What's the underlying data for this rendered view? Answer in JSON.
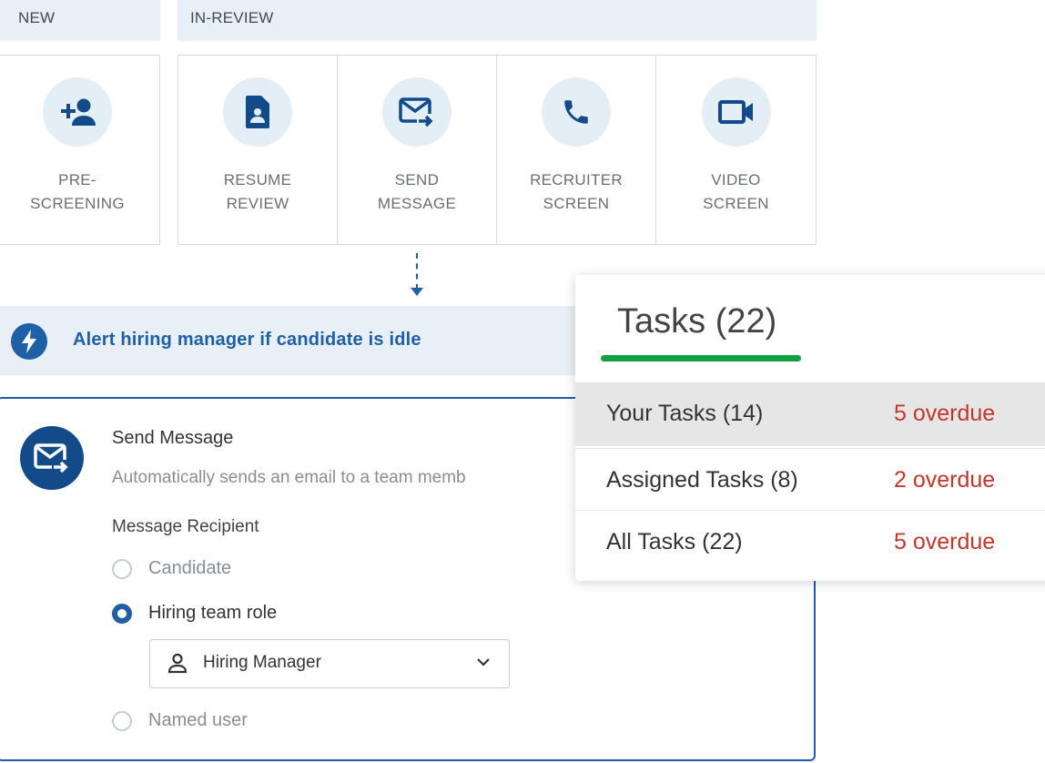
{
  "columns": {
    "new": "NEW",
    "in_review": "IN-REVIEW"
  },
  "stages": [
    {
      "label": "PRE-\nSCREENING",
      "icon": "add-person-icon"
    },
    {
      "label": "RESUME\nREVIEW",
      "icon": "document-person-icon"
    },
    {
      "label": "SEND\nMESSAGE",
      "icon": "mail-forward-icon"
    },
    {
      "label": "RECRUITER\nSCREEN",
      "icon": "phone-icon"
    },
    {
      "label": "VIDEO\nSCREEN",
      "icon": "video-camera-icon"
    }
  ],
  "alert": {
    "text": "Alert hiring manager if candidate is idle",
    "icon": "lightning-icon"
  },
  "send_message": {
    "title": "Send Message",
    "description": "Automatically sends an email to a team memb",
    "recipient_label": "Message Recipient",
    "options": [
      {
        "label": "Candidate",
        "selected": false
      },
      {
        "label": "Hiring team role",
        "selected": true
      },
      {
        "label": "Named user",
        "selected": false
      }
    ],
    "role_select": {
      "value": "Hiring Manager"
    }
  },
  "tasks": {
    "heading": "Tasks (22)",
    "rows": [
      {
        "name": "Your Tasks (14)",
        "overdue": "5 overdue",
        "active": true
      },
      {
        "name": "Assigned Tasks (8)",
        "overdue": "2 overdue",
        "active": false
      },
      {
        "name": "All Tasks (22)",
        "overdue": "5 overdue",
        "active": false
      }
    ]
  },
  "colors": {
    "accent": "#1e5fa6",
    "header_bg": "#e8eff6",
    "overdue": "#c4362c",
    "tab_underline": "#13a044"
  }
}
